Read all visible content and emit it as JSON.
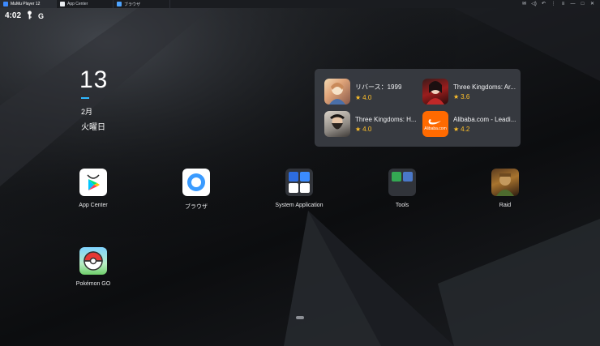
{
  "window": {
    "tabs": [
      {
        "label": "MuMu Player 12",
        "active": true
      },
      {
        "label": "App Center",
        "active": false
      },
      {
        "label": "ブラウザ",
        "active": false
      }
    ],
    "controls": [
      "✉",
      "◁)",
      "↶",
      "⋮",
      "≡",
      "—",
      "□",
      "✕"
    ]
  },
  "status": {
    "time": "4:02",
    "icons": [
      "key-icon",
      "google-icon"
    ],
    "g_label": "G"
  },
  "clock": {
    "day": "13",
    "month": "2月",
    "weekday": "火曜日"
  },
  "recommended": [
    {
      "name": "リバース：1999",
      "rating": "4.0",
      "icon": "reverse-1999-icon"
    },
    {
      "name": "Three Kingdoms: Ar...",
      "rating": "3.6",
      "icon": "three-kingdoms-ar-icon"
    },
    {
      "name": "Three Kingdoms: H...",
      "rating": "4.0",
      "icon": "three-kingdoms-h-icon"
    },
    {
      "name": "Alibaba.com - Leadi...",
      "rating": "4.2",
      "icon": "alibaba-icon",
      "brand": "Alibaba.com"
    }
  ],
  "apps": [
    {
      "label": "App Center",
      "icon": "app-center-icon"
    },
    {
      "label": "ブラウザ",
      "icon": "browser-icon"
    },
    {
      "label": "System Application",
      "icon": "system-folder-icon"
    },
    {
      "label": "Tools",
      "icon": "tools-folder-icon"
    },
    {
      "label": "Raid",
      "icon": "raid-icon"
    },
    {
      "label": "Pokémon GO",
      "icon": "pokemon-go-icon"
    }
  ],
  "colors": {
    "accent": "#2fb8ff",
    "rating": "#ffc02a",
    "card_bg": "#3a3d43",
    "alibaba": "#ff6a00"
  }
}
